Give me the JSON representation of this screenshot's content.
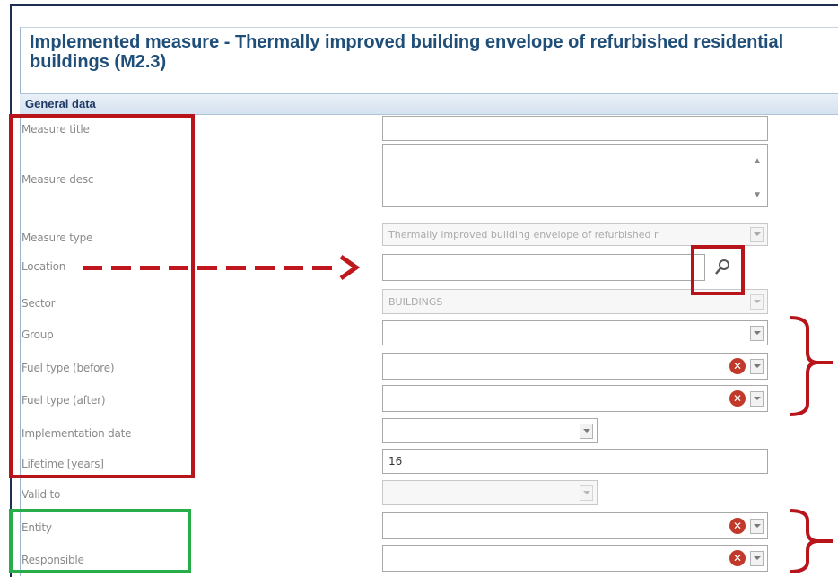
{
  "title": "Implemented measure - Thermally improved building envelope of refurbished residential buildings (M2.3)",
  "section_title": "General data",
  "labels": {
    "measure_title": "Measure title",
    "measure_desc": "Measure desc",
    "measure_type": "Measure type",
    "location": "Location",
    "sector": "Sector",
    "group": "Group",
    "fuel_before": "Fuel type (before)",
    "fuel_after": "Fuel type (after)",
    "implementation_date": "Implementation date",
    "lifetime": "Lifetime [years]",
    "valid_to": "Valid to",
    "entity": "Entity",
    "responsible": "Responsible"
  },
  "values": {
    "measure_type": "Thermally improved building envelope of refurbished r",
    "sector": "BUILDINGS",
    "lifetime": "16"
  },
  "icons": {
    "search": "magnifier-icon",
    "clear": "clear-icon",
    "dropdown": "chevron-down-icon"
  },
  "colors": {
    "title": "#1f4e79",
    "highlight_red": "#b8141c",
    "highlight_green": "#27ad4a"
  }
}
